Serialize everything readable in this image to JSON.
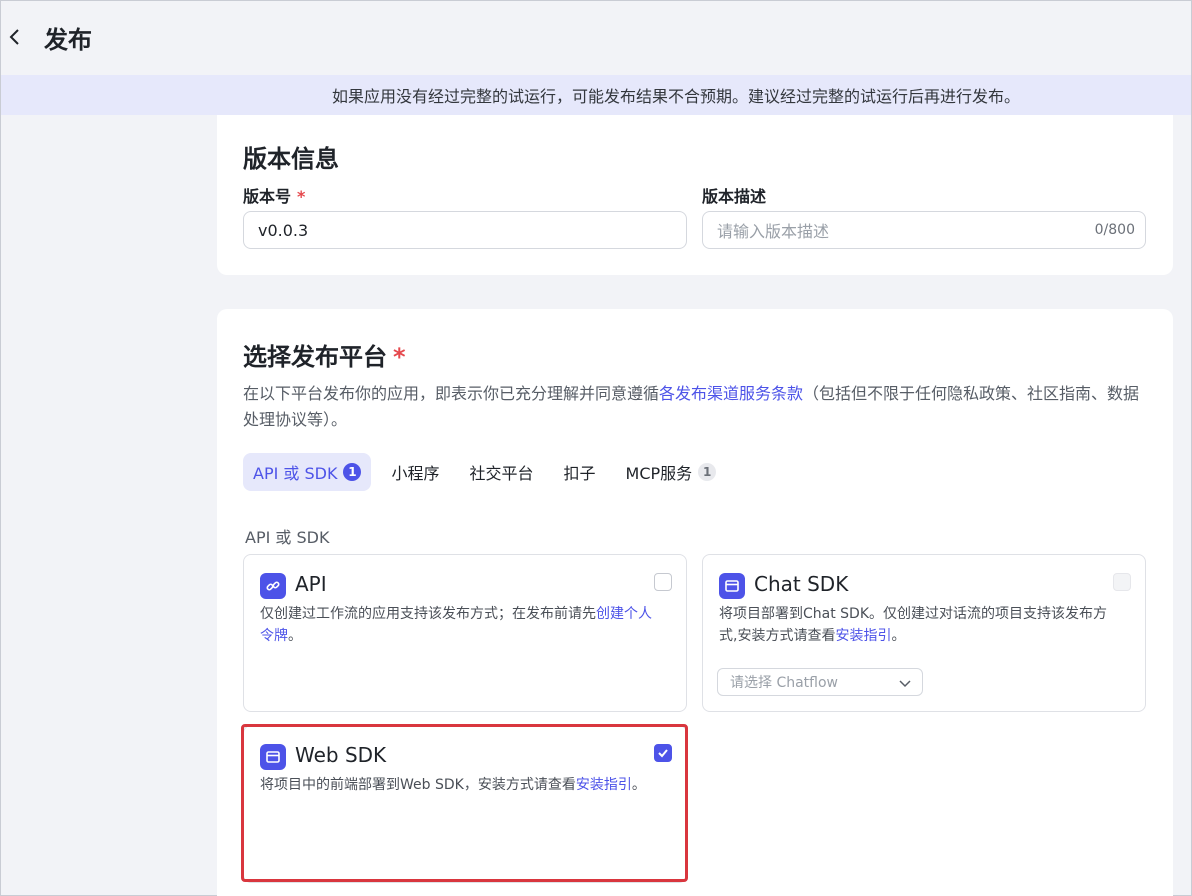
{
  "header": {
    "title": "发布",
    "back_icon": "chevron-left-icon"
  },
  "notice": {
    "text": "如果应用没有经过完整的试运行，可能发布结果不合预期。建议经过完整的试运行后再进行发布。"
  },
  "version_info": {
    "title": "版本信息",
    "version_label": "版本号",
    "required_mark": "*",
    "version_value": "v0.0.3",
    "description_label": "版本描述",
    "description_placeholder": "请输入版本描述",
    "description_counter": "0/800"
  },
  "platform": {
    "title": "选择发布平台",
    "required_mark": "*",
    "description_prefix": "在以下平台发布你的应用，即表示你已充分理解并同意遵循",
    "description_link": "各发布渠道服务条款",
    "description_suffix": "（包括但不限于任何隐私政策、社区指南、数据处理协议等）。",
    "tabs": [
      {
        "label": "API 或 SDK",
        "badge": "1",
        "active": true
      },
      {
        "label": "小程序",
        "badge": "",
        "active": false
      },
      {
        "label": "社交平台",
        "badge": "",
        "active": false
      },
      {
        "label": "扣子",
        "badge": "",
        "active": false
      },
      {
        "label": "MCP服务",
        "badge": "1",
        "active": false
      }
    ],
    "section_label": "API 或 SDK",
    "options": {
      "api": {
        "name": "API",
        "text": "仅创建过工作流的应用支持该发布方式；在发布前请先",
        "link": "创建个人令牌",
        "suffix": "。",
        "checked": false,
        "icon": "link-icon"
      },
      "chat_sdk": {
        "name": "Chat SDK",
        "text": "将项目部署到Chat SDK。仅创建过对话流的项目支持该发布方式,安装方式请查看",
        "link": "安装指引",
        "suffix": "。",
        "checked": false,
        "disabled": true,
        "icon": "window-icon",
        "select_placeholder": "请选择 Chatflow"
      },
      "web_sdk": {
        "name": "Web SDK",
        "text": "将项目中的前端部署到Web SDK，安装方式请查看",
        "link": "安装指引",
        "suffix": "。",
        "checked": true,
        "icon": "window-icon"
      }
    }
  },
  "colors": {
    "accent": "#4d53e8",
    "required": "#e5484d",
    "highlight_border": "#d9363e",
    "notice_bg": "#e6e8fb"
  }
}
